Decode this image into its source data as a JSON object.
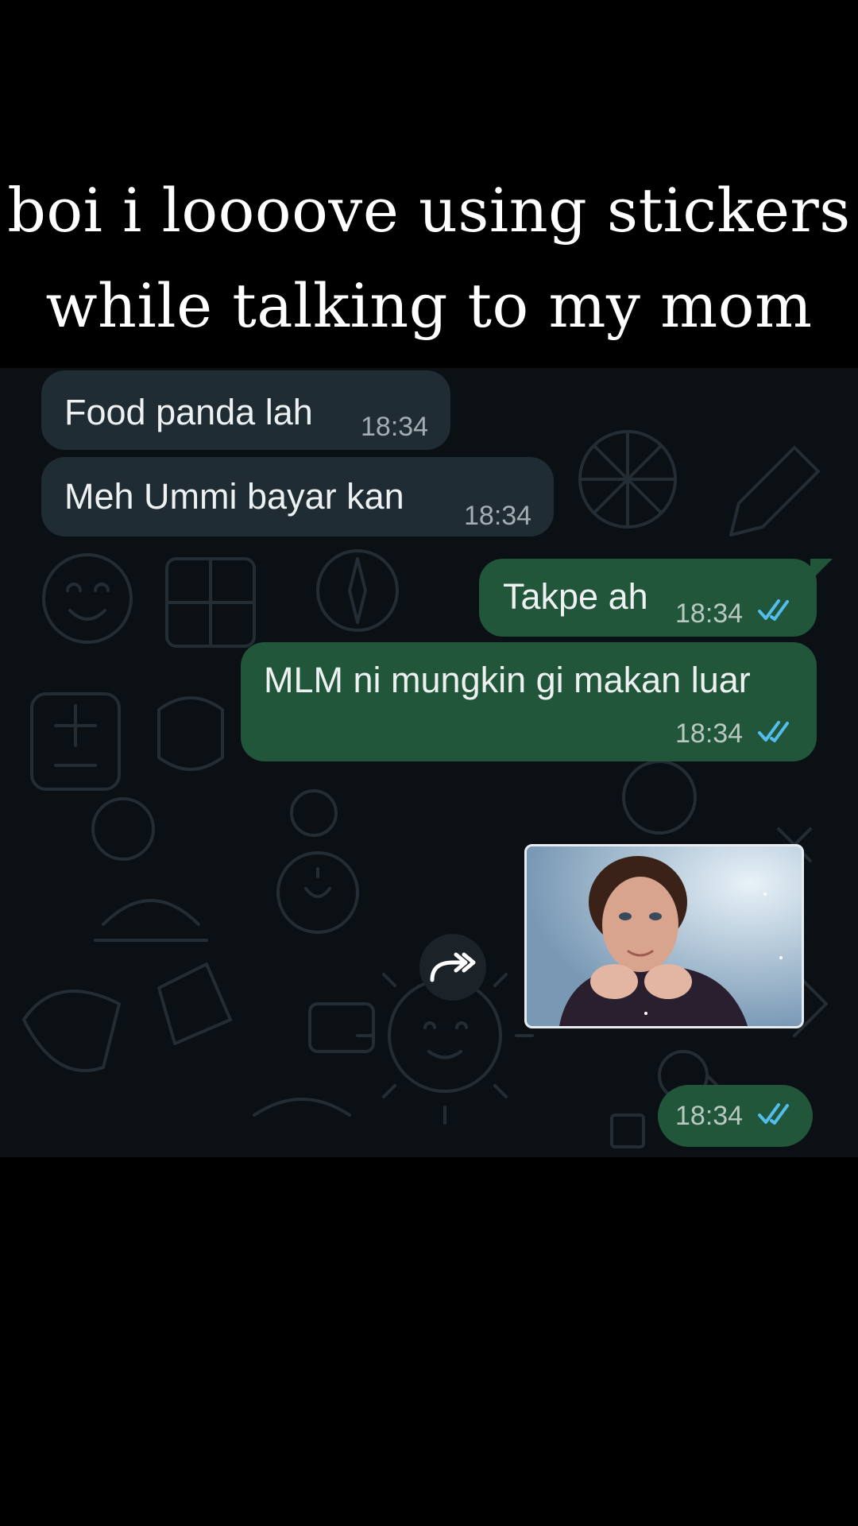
{
  "caption": {
    "line1": "boi i loooove using stickers",
    "line2": "while talking to my mom"
  },
  "messages": [
    {
      "direction": "incoming",
      "text": "Food panda lah",
      "time": "18:34"
    },
    {
      "direction": "incoming",
      "text": "Meh Ummi bayar kan",
      "time": "18:34"
    },
    {
      "direction": "outgoing",
      "text": "Takpe ah",
      "time": "18:34",
      "status": "read"
    },
    {
      "direction": "outgoing",
      "text": "MLM ni mungkin gi makan luar",
      "time": "18:34",
      "status": "read"
    },
    {
      "direction": "outgoing",
      "type": "sticker",
      "sticker": "portrait-photo-sticker",
      "time": "18:34",
      "status": "read"
    }
  ],
  "icons": {
    "forward": "forward-arrow-icon",
    "read_ticks": "double-check-icon"
  },
  "colors": {
    "chat_background": "#0b1014",
    "incoming_bubble": "#202c33",
    "outgoing_bubble": "#21563b",
    "read_tick": "#53bdeb"
  }
}
